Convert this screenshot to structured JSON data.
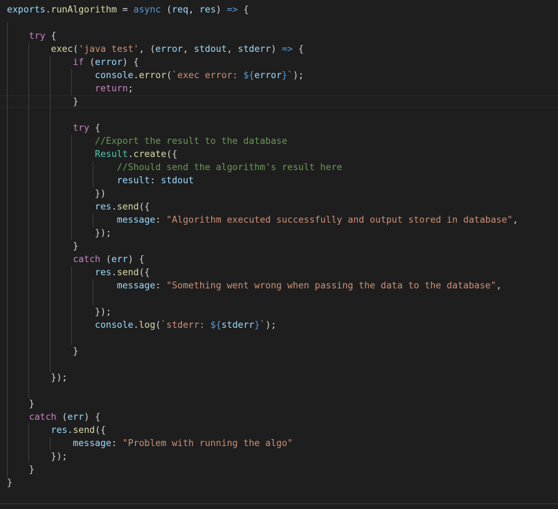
{
  "colors": {
    "background": "#1e1e1e",
    "keyword": "#c586c0",
    "storage": "#569cd6",
    "variable": "#9cdcfe",
    "function": "#dcdcaa",
    "type": "#4ec9b0",
    "string": "#ce9178",
    "comment": "#6a9955",
    "punctuation": "#d4d4d4"
  },
  "code": {
    "lines": [
      [
        {
          "t": "exports",
          "c": "v"
        },
        {
          "t": ".",
          "c": "p"
        },
        {
          "t": "runAlgorithm",
          "c": "f"
        },
        {
          "t": " = ",
          "c": "p"
        },
        {
          "t": "async",
          "c": "s"
        },
        {
          "t": " (",
          "c": "p"
        },
        {
          "t": "req",
          "c": "v"
        },
        {
          "t": ", ",
          "c": "p"
        },
        {
          "t": "res",
          "c": "v"
        },
        {
          "t": ") ",
          "c": "p"
        },
        {
          "t": "=>",
          "c": "o"
        },
        {
          "t": " {",
          "c": "p"
        }
      ],
      [],
      [
        {
          "t": "    ",
          "c": "p"
        },
        {
          "t": "try",
          "c": "k"
        },
        {
          "t": " {",
          "c": "p"
        }
      ],
      [
        {
          "t": "        ",
          "c": "p"
        },
        {
          "t": "exec",
          "c": "f"
        },
        {
          "t": "(",
          "c": "p"
        },
        {
          "t": "'java test'",
          "c": "str"
        },
        {
          "t": ", (",
          "c": "p"
        },
        {
          "t": "error",
          "c": "v"
        },
        {
          "t": ", ",
          "c": "p"
        },
        {
          "t": "stdout",
          "c": "v"
        },
        {
          "t": ", ",
          "c": "p"
        },
        {
          "t": "stderr",
          "c": "v"
        },
        {
          "t": ") ",
          "c": "p"
        },
        {
          "t": "=>",
          "c": "o"
        },
        {
          "t": " {",
          "c": "p"
        }
      ],
      [
        {
          "t": "            ",
          "c": "p"
        },
        {
          "t": "if",
          "c": "k"
        },
        {
          "t": " (",
          "c": "p"
        },
        {
          "t": "error",
          "c": "v"
        },
        {
          "t": ") {",
          "c": "p"
        }
      ],
      [
        {
          "t": "                ",
          "c": "p"
        },
        {
          "t": "console",
          "c": "v"
        },
        {
          "t": ".",
          "c": "p"
        },
        {
          "t": "error",
          "c": "f"
        },
        {
          "t": "(",
          "c": "p"
        },
        {
          "t": "`exec error: ",
          "c": "str"
        },
        {
          "t": "${",
          "c": "i"
        },
        {
          "t": "error",
          "c": "v"
        },
        {
          "t": "}",
          "c": "i"
        },
        {
          "t": "`",
          "c": "str"
        },
        {
          "t": ");",
          "c": "p"
        }
      ],
      [
        {
          "t": "                ",
          "c": "p"
        },
        {
          "t": "return",
          "c": "k"
        },
        {
          "t": ";",
          "c": "p"
        }
      ],
      [
        {
          "t": "            }",
          "c": "p"
        }
      ],
      [],
      [
        {
          "t": "            ",
          "c": "p"
        },
        {
          "t": "try",
          "c": "k"
        },
        {
          "t": " {",
          "c": "p"
        }
      ],
      [
        {
          "t": "                ",
          "c": "p"
        },
        {
          "t": "//Export the result to the database",
          "c": "c"
        }
      ],
      [
        {
          "t": "                ",
          "c": "p"
        },
        {
          "t": "Result",
          "c": "t"
        },
        {
          "t": ".",
          "c": "p"
        },
        {
          "t": "create",
          "c": "f"
        },
        {
          "t": "({",
          "c": "p"
        }
      ],
      [
        {
          "t": "                    ",
          "c": "p"
        },
        {
          "t": "//Should send the algorithm's result here",
          "c": "c"
        }
      ],
      [
        {
          "t": "                    ",
          "c": "p"
        },
        {
          "t": "result",
          "c": "v"
        },
        {
          "t": ": ",
          "c": "p"
        },
        {
          "t": "stdout",
          "c": "v"
        }
      ],
      [
        {
          "t": "                })",
          "c": "p"
        }
      ],
      [
        {
          "t": "                ",
          "c": "p"
        },
        {
          "t": "res",
          "c": "v"
        },
        {
          "t": ".",
          "c": "p"
        },
        {
          "t": "send",
          "c": "f"
        },
        {
          "t": "({",
          "c": "p"
        }
      ],
      [
        {
          "t": "                    ",
          "c": "p"
        },
        {
          "t": "message",
          "c": "v"
        },
        {
          "t": ": ",
          "c": "p"
        },
        {
          "t": "\"Algorithm executed successfully and output stored in database\"",
          "c": "str"
        },
        {
          "t": ",",
          "c": "p"
        }
      ],
      [
        {
          "t": "                });",
          "c": "p"
        }
      ],
      [
        {
          "t": "            }",
          "c": "p"
        }
      ],
      [
        {
          "t": "            ",
          "c": "p"
        },
        {
          "t": "catch",
          "c": "k"
        },
        {
          "t": " (",
          "c": "p"
        },
        {
          "t": "err",
          "c": "v"
        },
        {
          "t": ") {",
          "c": "p"
        }
      ],
      [
        {
          "t": "                ",
          "c": "p"
        },
        {
          "t": "res",
          "c": "v"
        },
        {
          "t": ".",
          "c": "p"
        },
        {
          "t": "send",
          "c": "f"
        },
        {
          "t": "({",
          "c": "p"
        }
      ],
      [
        {
          "t": "                    ",
          "c": "p"
        },
        {
          "t": "message",
          "c": "v"
        },
        {
          "t": ": ",
          "c": "p"
        },
        {
          "t": "\"Something went wrong when passing the data to the database\"",
          "c": "str"
        },
        {
          "t": ",",
          "c": "p"
        }
      ],
      [],
      [
        {
          "t": "                });",
          "c": "p"
        }
      ],
      [
        {
          "t": "                ",
          "c": "p"
        },
        {
          "t": "console",
          "c": "v"
        },
        {
          "t": ".",
          "c": "p"
        },
        {
          "t": "log",
          "c": "f"
        },
        {
          "t": "(",
          "c": "p"
        },
        {
          "t": "`stderr: ",
          "c": "str"
        },
        {
          "t": "${",
          "c": "i"
        },
        {
          "t": "stderr",
          "c": "v"
        },
        {
          "t": "}",
          "c": "i"
        },
        {
          "t": "`",
          "c": "str"
        },
        {
          "t": ");",
          "c": "p"
        }
      ],
      [],
      [
        {
          "t": "            }",
          "c": "p"
        }
      ],
      [],
      [
        {
          "t": "        });",
          "c": "p"
        }
      ],
      [],
      [
        {
          "t": "    }",
          "c": "p"
        }
      ],
      [
        {
          "t": "    ",
          "c": "p"
        },
        {
          "t": "catch",
          "c": "k"
        },
        {
          "t": " (",
          "c": "p"
        },
        {
          "t": "err",
          "c": "v"
        },
        {
          "t": ") {",
          "c": "p"
        }
      ],
      [
        {
          "t": "        ",
          "c": "p"
        },
        {
          "t": "res",
          "c": "v"
        },
        {
          "t": ".",
          "c": "p"
        },
        {
          "t": "send",
          "c": "f"
        },
        {
          "t": "({",
          "c": "p"
        }
      ],
      [
        {
          "t": "            ",
          "c": "p"
        },
        {
          "t": "message",
          "c": "v"
        },
        {
          "t": ": ",
          "c": "p"
        },
        {
          "t": "\"Problem with running the algo\"",
          "c": "str"
        }
      ],
      [
        {
          "t": "        });",
          "c": "p"
        }
      ],
      [
        {
          "t": "    }",
          "c": "p"
        }
      ],
      [
        {
          "t": "}",
          "c": "p"
        }
      ]
    ]
  }
}
